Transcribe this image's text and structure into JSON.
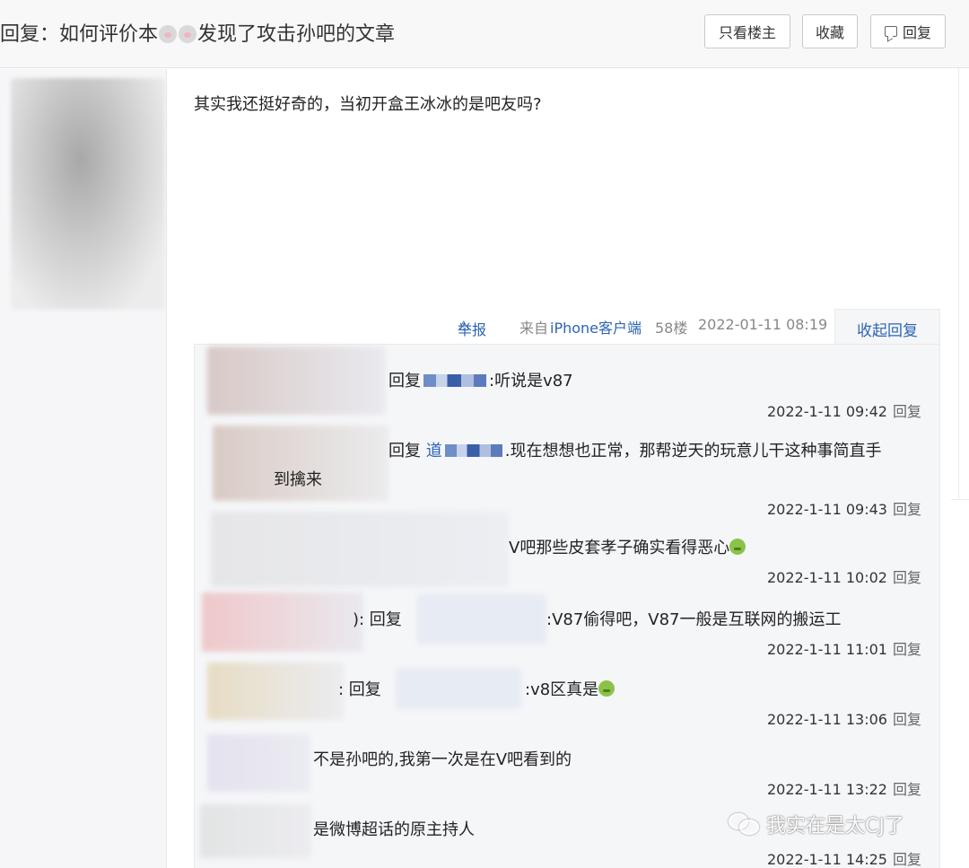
{
  "thread": {
    "title_prefix": "回复：如何评价本",
    "title_suffix": "发现了攻击孙吧的文章",
    "icon": "mouse-emoji-icon"
  },
  "header": {
    "only_op_label": "只看楼主",
    "favorite_label": "收藏",
    "reply_label": "回复"
  },
  "post": {
    "content": "其实我还挺好奇的，当初开盒王冰冰的是吧友吗?",
    "report_label": "举报",
    "source_label": "来自",
    "source_value": "iPhone客户端",
    "floor": "58楼",
    "time": "2022-01-11 08:19",
    "collapse_label": "收起回复"
  },
  "replies": [
    {
      "prefix": "回复",
      "text": ":听说是v87",
      "time": "2022-1-11 09:42",
      "reply_label": "回复"
    },
    {
      "prefix": "回复",
      "link": "道",
      "text": ".现在想想也正常，那帮逆天的玩意儿干这种事简直手",
      "text2": "到擒来",
      "time": "2022-1-11 09:43",
      "reply_label": "回复"
    },
    {
      "text": "V吧那些皮套孝子确实看得恶心",
      "emoji": "sick-face-emoji-icon",
      "time": "2022-1-11 10:02",
      "reply_label": "回复"
    },
    {
      "lead": "): 回复",
      "text": ":V87偷得吧，V87一般是互联网的搬运工",
      "time": "2022-1-11 11:01",
      "reply_label": "回复"
    },
    {
      "lead": ": 回复",
      "text": ":v8区真是",
      "emoji": "sick-face-emoji-icon",
      "time": "2022-1-11 13:06",
      "reply_label": "回复"
    },
    {
      "text": "不是孙吧的,我第一次是在V吧看到的",
      "time": "2022-1-11 13:22",
      "reply_label": "回复"
    },
    {
      "text": "是微博超话的原主持人",
      "time": "2022-1-11 14:25",
      "reply_label": "回复"
    }
  ],
  "watermark": {
    "text": "我实在是太CJ了",
    "icon": "wechat-icon"
  },
  "colors": {
    "link": "#2d64b3",
    "header_bg": "#f8f8f9",
    "reply_bg": "#f5f6f8"
  }
}
